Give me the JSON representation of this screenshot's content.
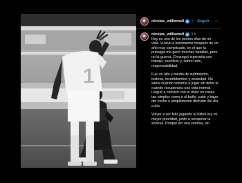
{
  "header": {
    "username": "nicolas_williams9",
    "separator": "•",
    "follow_label": "Seguir",
    "more_label": "..."
  },
  "comment": {
    "username": "nicolas_williams9",
    "time": "3 h",
    "paragraphs": [
      "Hoy es uno de los peores días de mi vida. Vuelvo a lesionarme después de un año muy complicado, en el que la pubalgia me ganó muchas batallas, pero no la guerra. Conseguí superarla con trabajo, sacrificio y, sobre todo, responsabilidad.",
      "Fue un año y medio de sufrimiento, tristeza, incertidumbre y ansiedad. No sabía cuándo volvería a jugar sin dolor ni cuándo recuperaría una vida normal. Llegué a convivir con el dolor en cosas tan simples como ir al baño, subir y bajar del coche o simplemente disfrutar del día a día.",
      "Volver a ser feliz jugando al fútbol era mi mayor prioridad, junto a recuperar la sonrisa. Porque sin una sonrisa, sin"
    ]
  },
  "photo": {
    "jersey_number": "1"
  },
  "colors": {
    "background": "#000000",
    "text": "#f5f5f5",
    "muted": "#a8a8a8",
    "follow": "#3aa7f0",
    "verified": "#3aa7f0"
  },
  "icons": {
    "verified": "verified-badge-icon",
    "more": "more-options-icon"
  }
}
